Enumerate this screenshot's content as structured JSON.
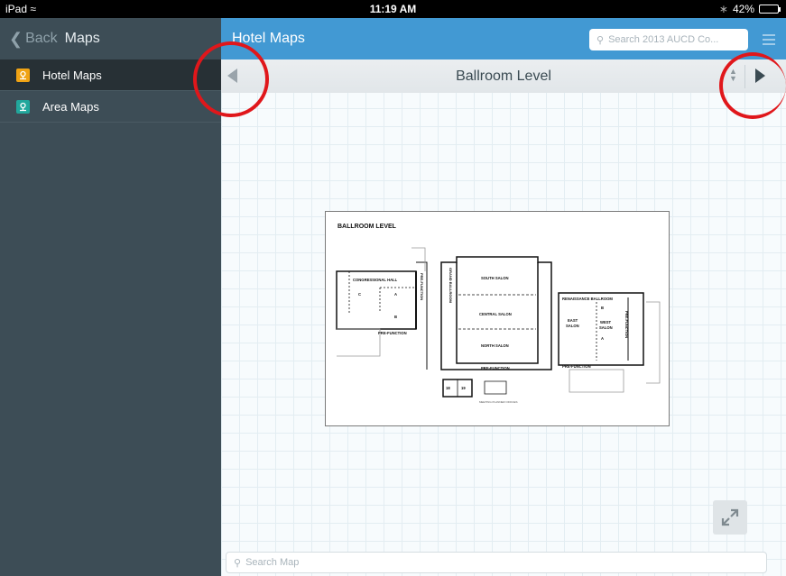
{
  "status_bar": {
    "device": "iPad",
    "time": "11:19 AM",
    "battery": "42%",
    "battery_level": 0.42
  },
  "sidebar": {
    "back_label": "Back",
    "title": "Maps",
    "items": [
      {
        "label": "Hotel Maps",
        "icon": "map-pin-icon",
        "color": "#f0a314",
        "active": true
      },
      {
        "label": "Area Maps",
        "icon": "map-pin-icon",
        "color": "#21a79c",
        "active": false
      }
    ]
  },
  "main": {
    "title": "Hotel Maps",
    "search_placeholder": "Search 2013 AUCD Co...",
    "level_title": "Ballroom Level",
    "map_title": "BALLROOM LEVEL",
    "map_labels": {
      "congressional_hall": "CONGRESSIONAL HALL",
      "c": "C",
      "a": "A",
      "b": "B",
      "pre_function": "PRE-FUNCTION",
      "south_salon": "SOUTH SALON",
      "central_salon": "CENTRAL SALON",
      "north_salon": "NORTH SALON",
      "grand_ballroom": "GRAND BALLROOM",
      "renaissance_ballroom": "RENAISSANCE BALLROOM",
      "east_salon_1": "EAST",
      "east_salon_2": "SALON",
      "west_salon_1": "WEST",
      "west_salon_2": "SALON",
      "meeting_planner": "MEETING PLANNER OFFICES",
      "room_18": "18",
      "room_19": "19"
    },
    "search_map_placeholder": "Search Map"
  },
  "colors": {
    "topbar": "#4299d3",
    "sidebar": "#3d4d56",
    "sidebar_active": "#273035",
    "annotation": "#e0171b"
  }
}
